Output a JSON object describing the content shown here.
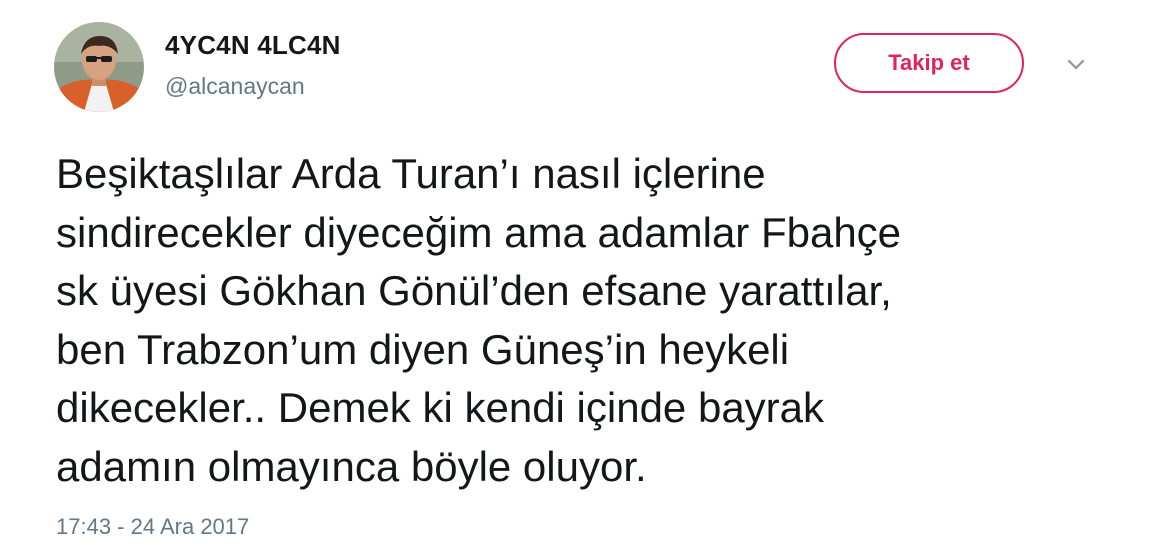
{
  "header": {
    "display_name": "4YC4N 4LC4N",
    "handle": "@alcanaycan",
    "avatar": "avatar",
    "follow_label": "Takip et",
    "menu_icon": "chevron-down-icon"
  },
  "tweet": {
    "lines": [
      "Beşiktaşlılar Arda Turan’ı nasıl içlerine",
      "sindirecekler diyeceğim ama adamlar Fbahçe",
      "sk üyesi Gökhan Gönül’den efsane yarattılar,",
      "ben Trabzon’um diyen Güneş’in heykeli",
      "dikecekler.. Demek ki kendi içinde bayrak",
      "adamın olmayınca böyle oluyor."
    ],
    "timestamp": "17:43 - 24 Ara 2017"
  },
  "colors": {
    "accent": "#e0245e",
    "text": "#14171a",
    "secondary": "#657786"
  }
}
